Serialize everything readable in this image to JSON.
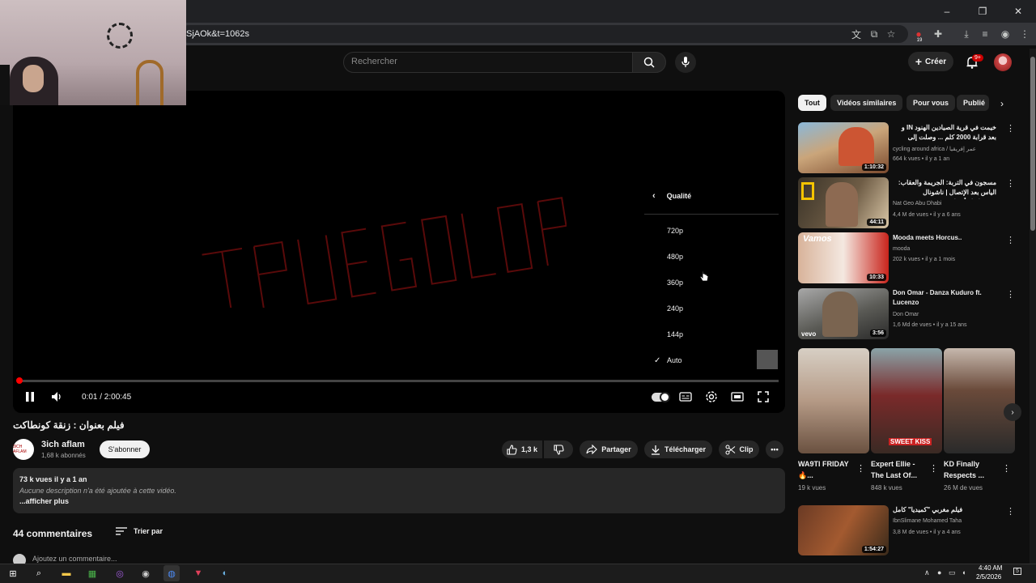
{
  "browser": {
    "url_fragment": "SjAOk&t=1062s",
    "window_controls": [
      "–",
      "❐",
      "✕"
    ],
    "extension_badge": "19"
  },
  "header": {
    "search_placeholder": "Rechercher",
    "create_label": "Créer",
    "notifications_badge": "9+"
  },
  "player": {
    "quality_menu": {
      "title": "Qualité",
      "options": [
        "720p",
        "480p",
        "360p",
        "240p",
        "144p",
        "Auto"
      ],
      "selected": "Auto"
    },
    "time": "0:01 / 2:00:45",
    "progress_fraction": 0.001,
    "colors": {
      "progress": "#ff0000",
      "logo_outline": "#8b0000"
    }
  },
  "video": {
    "title": "فيلم بعنوان : زنقة كونطاكت",
    "channel": {
      "name": "3ich aflam",
      "subscribers": "1,68 k abonnés",
      "avatar_text": "3ICH AFLAM"
    },
    "subscribe_label": "S'abonner",
    "like_count": "1,3 k",
    "share_label": "Partager",
    "download_label": "Télécharger",
    "clip_label": "Clip",
    "description": {
      "meta": "73 k vues  il y a 1 an",
      "text": "Aucune description n'a été ajoutée à cette vidéo.",
      "more": "...afficher plus"
    },
    "comments": {
      "count_label": "44 commentaires",
      "sort_label": "Trier par",
      "add_placeholder": "Ajoutez un commentaire..."
    }
  },
  "sidebar": {
    "chips": [
      "Tout",
      "Vidéos similaires",
      "Pour vous",
      "Publié"
    ],
    "recommendations": [
      {
        "title": "خيمت في قرية الصيادين الهنود IN و بعد قرابة 2000 كلم ... وصلت إلى مدينة ...",
        "channel": "cycling around africa / عمر إفريقيا",
        "meta": "664 k vues • il y a 1 an",
        "duration": "1:10:32",
        "rtl": true
      },
      {
        "title": "مسجون في التربة: الجريمة والعقاب: الياس بعد الإتصال | ناشونال جيوغرافيك أبوظبي",
        "channel": "Nat Geo Abu Dhabi",
        "meta": "4,4 M de vues • il y a 6 ans",
        "duration": "44:11",
        "rtl": true
      },
      {
        "title": "Mooda meets Horcus..",
        "channel": "mooda",
        "meta": "202 k vues • il y a 1 mois",
        "duration": "10:33",
        "rtl": false,
        "thumb_text": "Vamos"
      },
      {
        "title": "Don Omar - Danza Kuduro ft. Lucenzo",
        "channel": "Don Omar",
        "meta": "1,6 Md de vues • il y a 15 ans",
        "duration": "3:56",
        "rtl": false,
        "thumb_text": "vevo"
      }
    ],
    "shorts": [
      {
        "title": "WA9TI FRIDAY 🔥...",
        "views": "19 k vues"
      },
      {
        "title": "Expert Ellie - The Last Of...",
        "views": "848 k vues",
        "thumb_text": "SWEET KISS"
      },
      {
        "title": "KD Finally Respects ...",
        "views": "26 M de vues"
      }
    ],
    "last_recommendation": {
      "title": "فيلم مغربي \"كميديا\" كامل",
      "channel": "IbnSlimane Mohamed Taha",
      "meta": "3,8 M de vues • il y a 4 ans",
      "duration": "1:54:27"
    }
  },
  "taskbar": {
    "time": "4:40 AM",
    "date": "2/5/2026",
    "notification_count": "5"
  }
}
